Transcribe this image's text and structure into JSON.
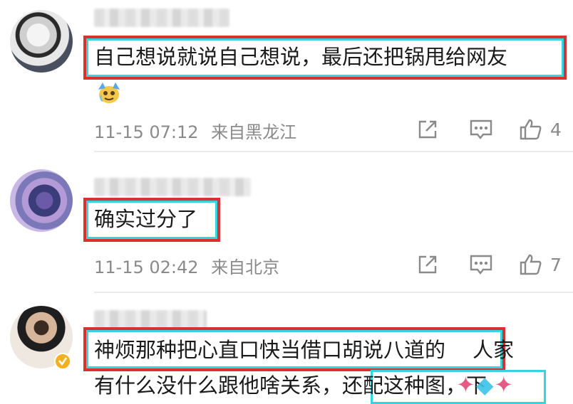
{
  "comments": [
    {
      "text": "自己想说就说自己想说，最后还把锅甩给网友",
      "time": "11-15 07:12",
      "source": "来自黑龙江",
      "likes": "4"
    },
    {
      "text": "确实过分了",
      "time": "11-15 02:42",
      "source": "来自北京",
      "likes": "7"
    },
    {
      "line1_highlight": "神烦那种把心直口快当借口胡说八道的",
      "line1_rest": "人家",
      "line2_start": "有什么没什么跟他啥关系，",
      "line2_highlight": "还配这种图，",
      "line2_end": "下"
    }
  ],
  "icons": [
    "share-icon",
    "comment-icon",
    "thumb-up-icon",
    "emoji-icon",
    "verified-badge-icon"
  ],
  "colors": {
    "highlight_red": "#d93030",
    "highlight_cyan": "#38d3e0",
    "verified_badge": "#f2b01e"
  }
}
